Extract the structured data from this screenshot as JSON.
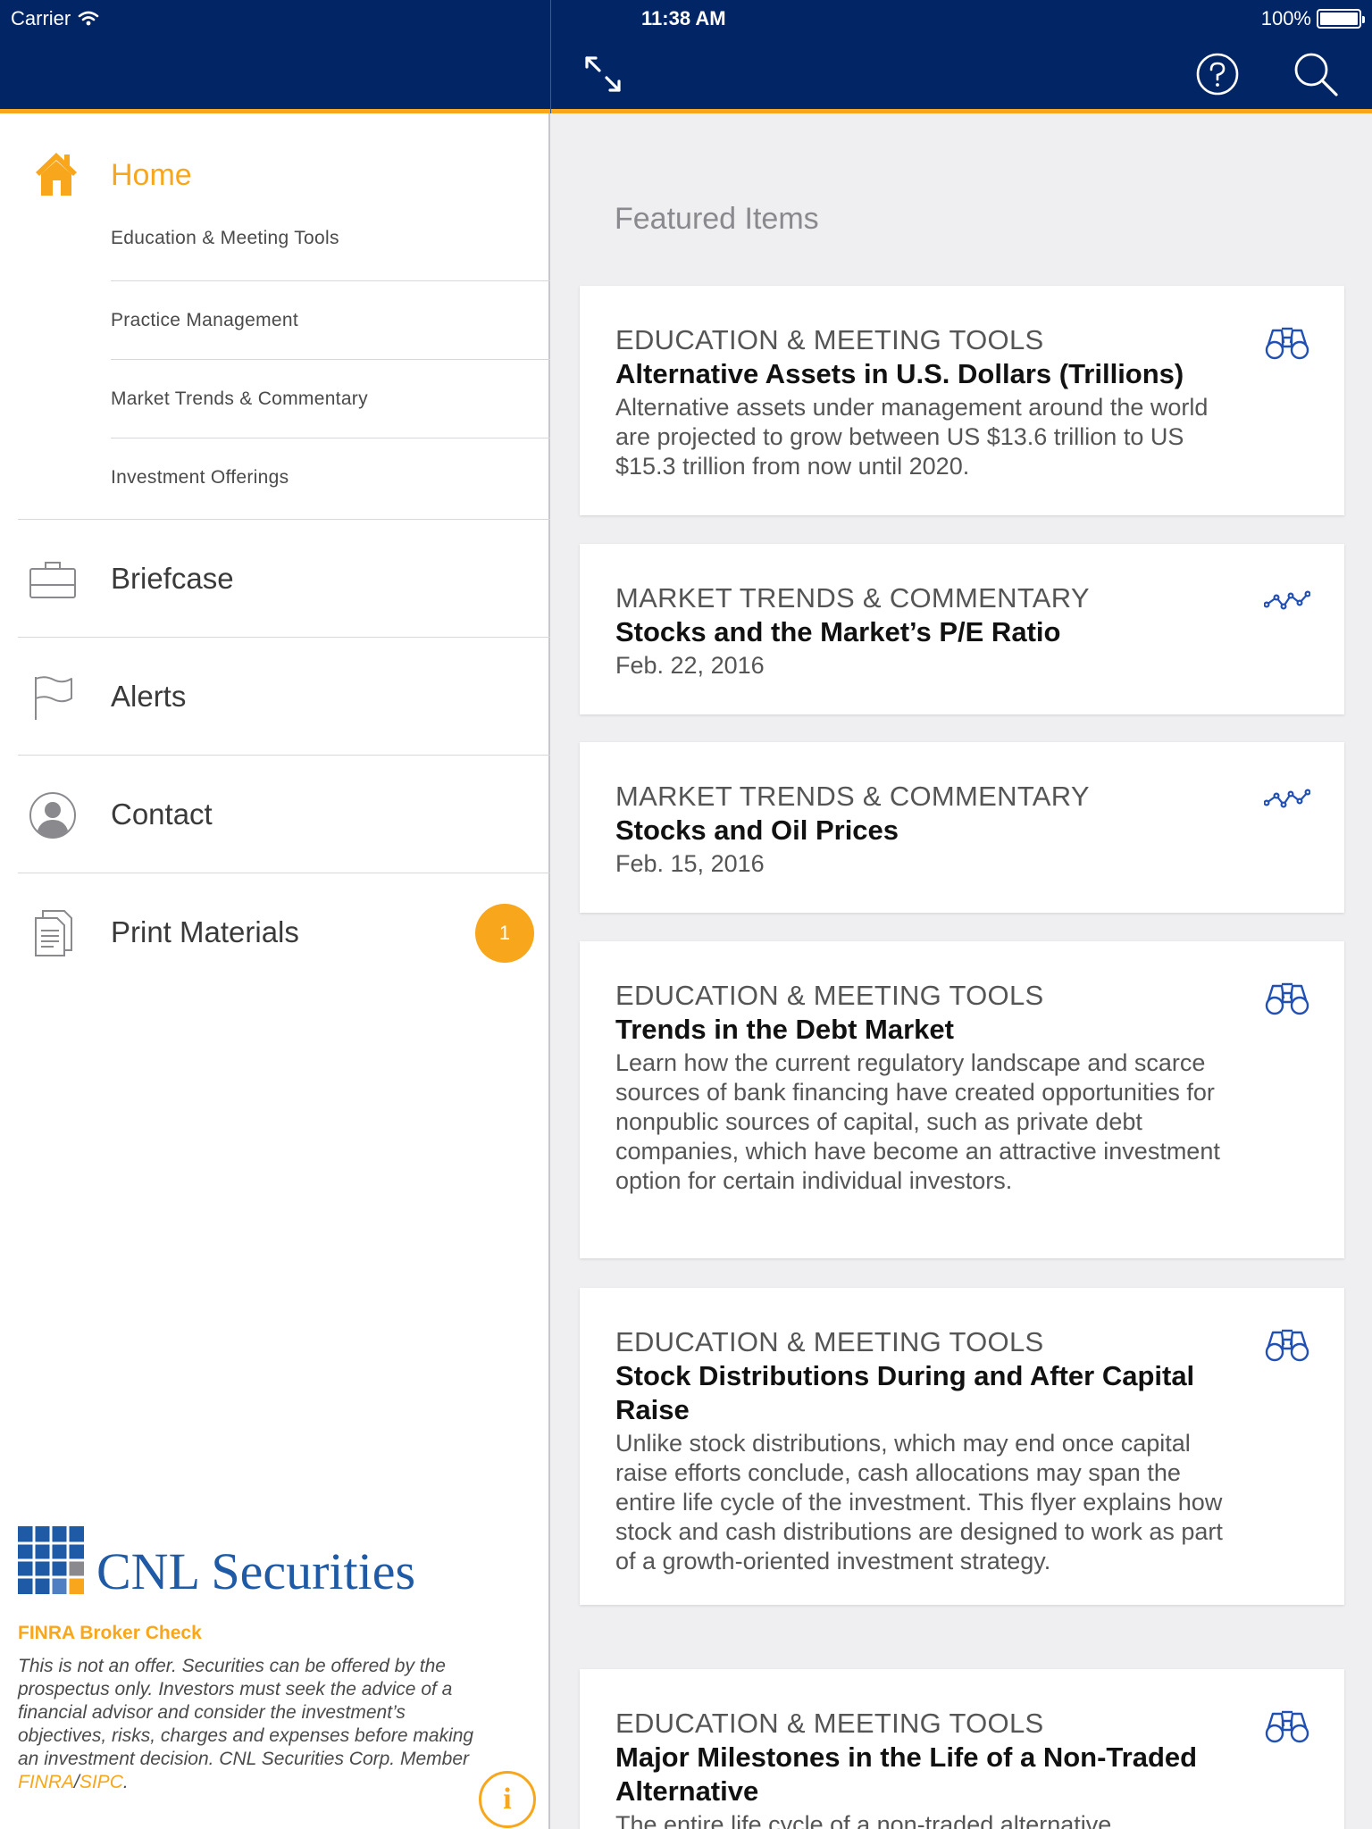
{
  "status_bar": {
    "carrier": "Carrier",
    "time": "11:38 AM",
    "battery": "100%"
  },
  "sidebar": {
    "home": {
      "label": "Home"
    },
    "home_subitems": [
      {
        "label": "Education & Meeting Tools"
      },
      {
        "label": "Practice Management"
      },
      {
        "label": "Market Trends & Commentary"
      },
      {
        "label": "Investment Offerings"
      }
    ],
    "nav": [
      {
        "label": "Briefcase",
        "icon": "briefcase-icon"
      },
      {
        "label": "Alerts",
        "icon": "flag-icon"
      },
      {
        "label": "Contact",
        "icon": "person-icon"
      },
      {
        "label": "Print Materials",
        "icon": "document-icon",
        "badge": "1"
      }
    ],
    "brand": {
      "logo_text": "CNL Securities",
      "broker_check": "FINRA Broker Check",
      "disclaimer_main": "This is not an offer. Securities can be offered by the prospectus only. Investors must seek the advice of a financial advisor and consider the investment’s objectives, risks, charges and expenses before making an investment decision. CNL Securities Corp. Member ",
      "disclaimer_finra": "FINRA",
      "disclaimer_sep": "/",
      "disclaimer_sipc": "SIPC",
      "disclaimer_end": "."
    }
  },
  "main": {
    "section_title": "Featured Items",
    "cards": [
      {
        "category": "EDUCATION & MEETING TOOLS",
        "title": "Alternative Assets in U.S. Dollars (Trillions)",
        "description": "Alternative assets under management around the world are projected to grow between US $13.6 trillion to US $15.3 trillion from now until 2020.",
        "icon": "binoculars-icon"
      },
      {
        "category": "MARKET TRENDS & COMMENTARY",
        "title": "Stocks and the Market’s P/E Ratio",
        "description": "Feb. 22, 2016",
        "icon": "trend-line-icon"
      },
      {
        "category": "MARKET TRENDS & COMMENTARY",
        "title": "Stocks and Oil Prices",
        "description": "Feb. 15, 2016",
        "icon": "trend-line-icon"
      },
      {
        "category": "EDUCATION & MEETING TOOLS",
        "title": "Trends in the Debt Market",
        "description": "Learn how the current regulatory landscape and scarce sources of bank financing have created opportunities for nonpublic sources of capital, such as private debt companies, which have become an attractive investment option for certain individual investors.",
        "icon": "binoculars-icon"
      },
      {
        "category": "EDUCATION & MEETING TOOLS",
        "title": "Stock Distributions During and After Capital Raise",
        "description": "Unlike stock distributions, which may end once capital raise efforts conclude, cash allocations may span the entire life cycle of the investment. This flyer explains how stock and cash distributions are designed to work as part of a growth-oriented investment strategy.",
        "icon": "binoculars-icon"
      },
      {
        "category": "EDUCATION & MEETING TOOLS",
        "title": "Major Milestones in the Life of a Non-Traded Alternative",
        "description": "The entire life cycle of a non-traded alternative",
        "icon": "binoculars-icon"
      }
    ]
  },
  "colors": {
    "navy": "#022566",
    "orange": "#f8a71c",
    "icon_blue": "#2050b4"
  }
}
